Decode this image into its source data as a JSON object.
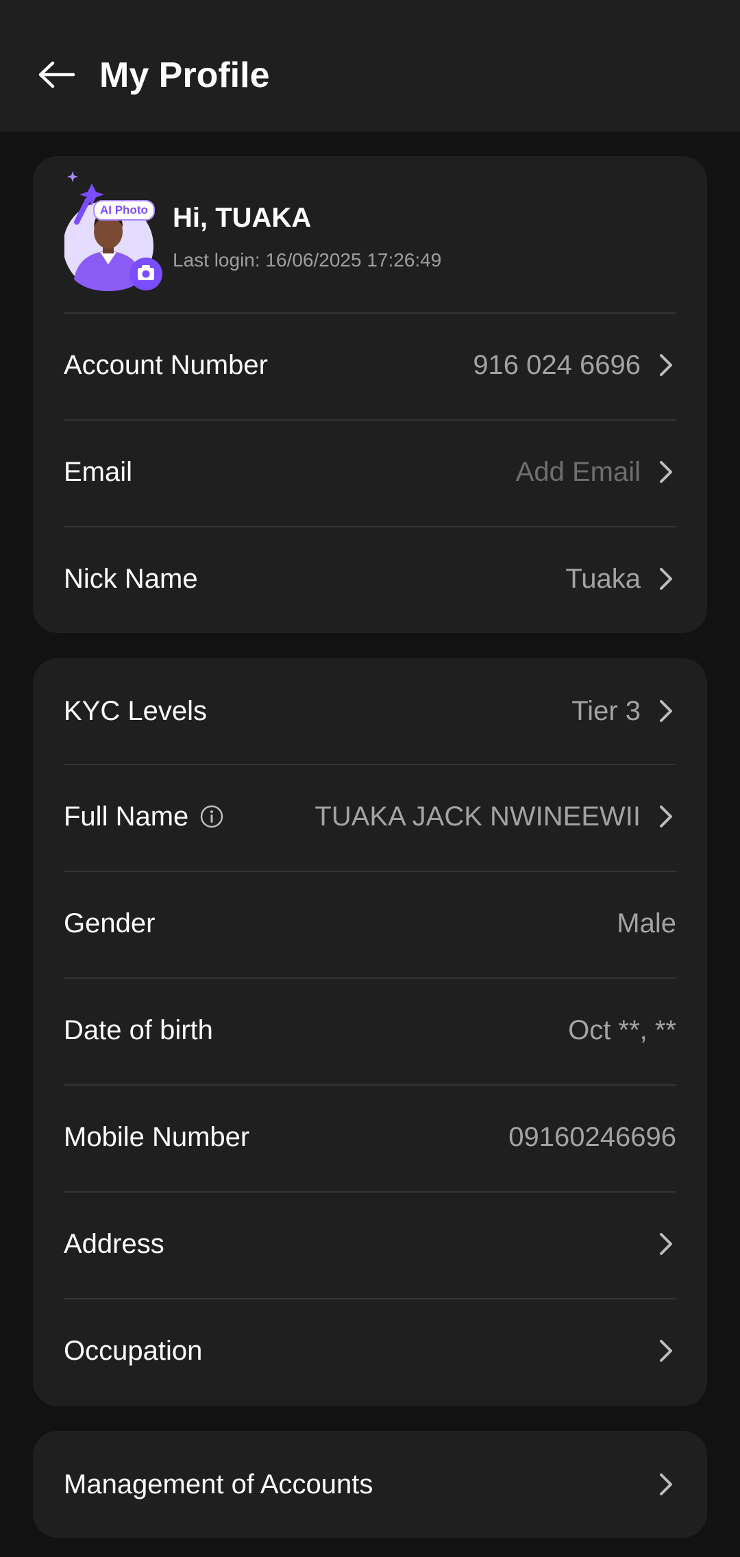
{
  "header": {
    "title": "My Profile",
    "back_icon": "arrow-left-icon"
  },
  "profile": {
    "badge": "AI Photo",
    "greeting": "Hi, TUAKA",
    "last_login": "Last login: 16/06/2025 17:26:49",
    "accent": "#7a4dff"
  },
  "account_card": {
    "rows": [
      {
        "label": "Account Number",
        "value": "916 024 6696"
      },
      {
        "label": "Email",
        "value": "Add Email"
      },
      {
        "label": "Nick Name",
        "value": "Tuaka"
      }
    ]
  },
  "kyc_card": {
    "rows": [
      {
        "label": "KYC Levels",
        "value": "Tier 3"
      },
      {
        "label": "Full Name",
        "value": "TUAKA JACK NWINEEWII"
      },
      {
        "label": "Gender",
        "value": "Male"
      },
      {
        "label": "Date of birth",
        "value": "Oct **, **"
      },
      {
        "label": "Mobile Number",
        "value": "09160246696"
      },
      {
        "label": "Address",
        "value": ""
      },
      {
        "label": "Occupation",
        "value": ""
      }
    ]
  },
  "management_card": {
    "label": "Management of Accounts"
  }
}
